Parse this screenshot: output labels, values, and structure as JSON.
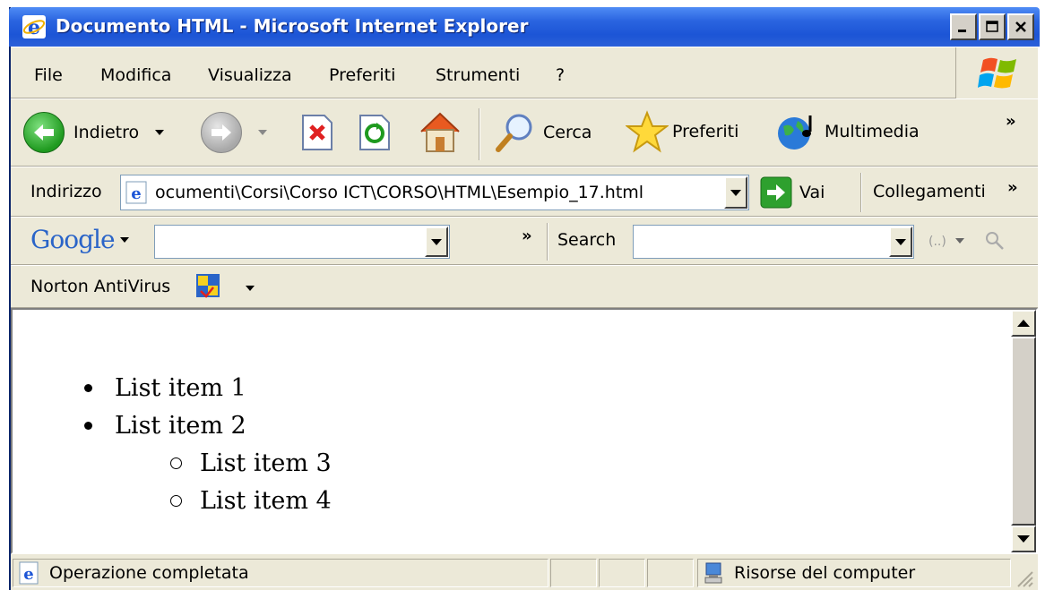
{
  "window": {
    "title": "Documento HTML - Microsoft Internet Explorer",
    "minimize_label": "_",
    "maximize_label": "□",
    "close_label": "X"
  },
  "menubar": {
    "items": [
      "File",
      "Modifica",
      "Visualizza",
      "Preferiti",
      "Strumenti",
      "?"
    ]
  },
  "toolbar": {
    "back_label": "Indietro",
    "search_label": "Cerca",
    "favorites_label": "Preferiti",
    "media_label": "Multimedia",
    "more_chevron": "»"
  },
  "addressbar": {
    "label": "Indirizzo",
    "value": "ocumenti\\Corsi\\Corso ICT\\CORSO\\HTML\\Esempio_17.html",
    "go_label": "Vai",
    "links_label": "Collegamenti",
    "links_chevron": "»"
  },
  "googlebar": {
    "logo_text": "Google",
    "search_value": "",
    "chevron": "»",
    "search_label": "Search",
    "search2_value": ""
  },
  "nortonbar": {
    "label": "Norton AntiVirus"
  },
  "document": {
    "list": [
      {
        "text": "List item 1",
        "level": 1
      },
      {
        "text": "List item 2",
        "level": 1
      },
      {
        "text": "List item 3",
        "level": 2
      },
      {
        "text": "List item 4",
        "level": 2
      }
    ]
  },
  "statusbar": {
    "status_text": "Operazione completata",
    "zone_text": "Risorse del computer"
  },
  "colors": {
    "titlebar": "#2a64e0",
    "chrome": "#ece9d8",
    "content_bg": "#ffffff"
  }
}
